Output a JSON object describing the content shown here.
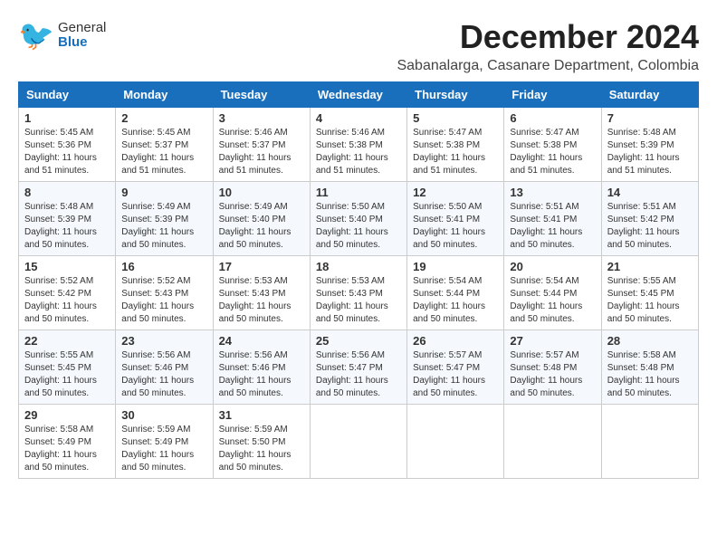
{
  "logo": {
    "general": "General",
    "blue": "Blue"
  },
  "title": "December 2024",
  "location": "Sabanalarga, Casanare Department, Colombia",
  "headers": [
    "Sunday",
    "Monday",
    "Tuesday",
    "Wednesday",
    "Thursday",
    "Friday",
    "Saturday"
  ],
  "weeks": [
    [
      {
        "day": "1",
        "sunrise": "5:45 AM",
        "sunset": "5:36 PM",
        "daylight": "11 hours and 51 minutes."
      },
      {
        "day": "2",
        "sunrise": "5:45 AM",
        "sunset": "5:37 PM",
        "daylight": "11 hours and 51 minutes."
      },
      {
        "day": "3",
        "sunrise": "5:46 AM",
        "sunset": "5:37 PM",
        "daylight": "11 hours and 51 minutes."
      },
      {
        "day": "4",
        "sunrise": "5:46 AM",
        "sunset": "5:38 PM",
        "daylight": "11 hours and 51 minutes."
      },
      {
        "day": "5",
        "sunrise": "5:47 AM",
        "sunset": "5:38 PM",
        "daylight": "11 hours and 51 minutes."
      },
      {
        "day": "6",
        "sunrise": "5:47 AM",
        "sunset": "5:38 PM",
        "daylight": "11 hours and 51 minutes."
      },
      {
        "day": "7",
        "sunrise": "5:48 AM",
        "sunset": "5:39 PM",
        "daylight": "11 hours and 51 minutes."
      }
    ],
    [
      {
        "day": "8",
        "sunrise": "5:48 AM",
        "sunset": "5:39 PM",
        "daylight": "11 hours and 50 minutes."
      },
      {
        "day": "9",
        "sunrise": "5:49 AM",
        "sunset": "5:39 PM",
        "daylight": "11 hours and 50 minutes."
      },
      {
        "day": "10",
        "sunrise": "5:49 AM",
        "sunset": "5:40 PM",
        "daylight": "11 hours and 50 minutes."
      },
      {
        "day": "11",
        "sunrise": "5:50 AM",
        "sunset": "5:40 PM",
        "daylight": "11 hours and 50 minutes."
      },
      {
        "day": "12",
        "sunrise": "5:50 AM",
        "sunset": "5:41 PM",
        "daylight": "11 hours and 50 minutes."
      },
      {
        "day": "13",
        "sunrise": "5:51 AM",
        "sunset": "5:41 PM",
        "daylight": "11 hours and 50 minutes."
      },
      {
        "day": "14",
        "sunrise": "5:51 AM",
        "sunset": "5:42 PM",
        "daylight": "11 hours and 50 minutes."
      }
    ],
    [
      {
        "day": "15",
        "sunrise": "5:52 AM",
        "sunset": "5:42 PM",
        "daylight": "11 hours and 50 minutes."
      },
      {
        "day": "16",
        "sunrise": "5:52 AM",
        "sunset": "5:43 PM",
        "daylight": "11 hours and 50 minutes."
      },
      {
        "day": "17",
        "sunrise": "5:53 AM",
        "sunset": "5:43 PM",
        "daylight": "11 hours and 50 minutes."
      },
      {
        "day": "18",
        "sunrise": "5:53 AM",
        "sunset": "5:43 PM",
        "daylight": "11 hours and 50 minutes."
      },
      {
        "day": "19",
        "sunrise": "5:54 AM",
        "sunset": "5:44 PM",
        "daylight": "11 hours and 50 minutes."
      },
      {
        "day": "20",
        "sunrise": "5:54 AM",
        "sunset": "5:44 PM",
        "daylight": "11 hours and 50 minutes."
      },
      {
        "day": "21",
        "sunrise": "5:55 AM",
        "sunset": "5:45 PM",
        "daylight": "11 hours and 50 minutes."
      }
    ],
    [
      {
        "day": "22",
        "sunrise": "5:55 AM",
        "sunset": "5:45 PM",
        "daylight": "11 hours and 50 minutes."
      },
      {
        "day": "23",
        "sunrise": "5:56 AM",
        "sunset": "5:46 PM",
        "daylight": "11 hours and 50 minutes."
      },
      {
        "day": "24",
        "sunrise": "5:56 AM",
        "sunset": "5:46 PM",
        "daylight": "11 hours and 50 minutes."
      },
      {
        "day": "25",
        "sunrise": "5:56 AM",
        "sunset": "5:47 PM",
        "daylight": "11 hours and 50 minutes."
      },
      {
        "day": "26",
        "sunrise": "5:57 AM",
        "sunset": "5:47 PM",
        "daylight": "11 hours and 50 minutes."
      },
      {
        "day": "27",
        "sunrise": "5:57 AM",
        "sunset": "5:48 PM",
        "daylight": "11 hours and 50 minutes."
      },
      {
        "day": "28",
        "sunrise": "5:58 AM",
        "sunset": "5:48 PM",
        "daylight": "11 hours and 50 minutes."
      }
    ],
    [
      {
        "day": "29",
        "sunrise": "5:58 AM",
        "sunset": "5:49 PM",
        "daylight": "11 hours and 50 minutes."
      },
      {
        "day": "30",
        "sunrise": "5:59 AM",
        "sunset": "5:49 PM",
        "daylight": "11 hours and 50 minutes."
      },
      {
        "day": "31",
        "sunrise": "5:59 AM",
        "sunset": "5:50 PM",
        "daylight": "11 hours and 50 minutes."
      },
      null,
      null,
      null,
      null
    ]
  ],
  "labels": {
    "sunrise_prefix": "Sunrise: ",
    "sunset_prefix": "Sunset: ",
    "daylight_prefix": "Daylight: "
  }
}
